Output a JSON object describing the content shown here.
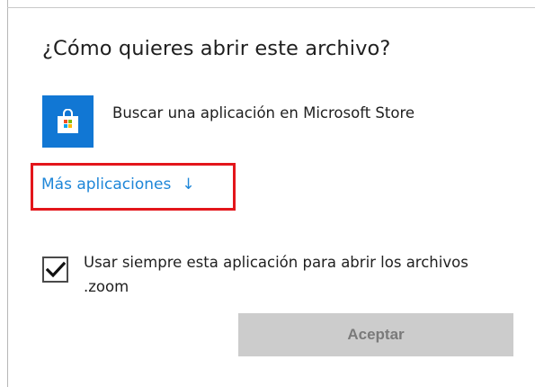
{
  "dialog": {
    "title": "¿Cómo quieres abrir este archivo?",
    "store_option": {
      "label": "Buscar una aplicación en Microsoft Store",
      "icon": "microsoft-store-icon"
    },
    "more_apps_label": "Más aplicaciones",
    "more_apps_arrow": "↓",
    "always_use": {
      "label": "Usar siempre esta aplicación para abrir los archivos .zoom",
      "checked": true
    },
    "accept_label": "Aceptar"
  },
  "colors": {
    "store_tile": "#1177d4",
    "link": "#1e86d8",
    "highlight_border": "#e3161b",
    "button_bg": "#cccccc",
    "button_text": "#7a7a7a"
  }
}
